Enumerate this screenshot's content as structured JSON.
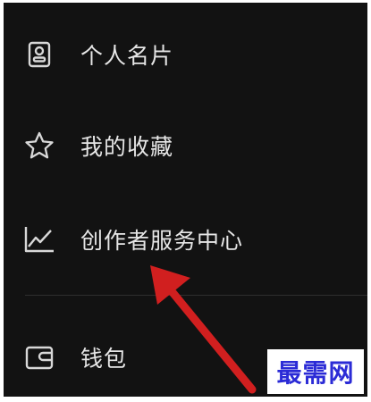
{
  "menu": {
    "items": [
      {
        "label": "个人名片",
        "icon": "contact-card-icon"
      },
      {
        "label": "我的收藏",
        "icon": "star-icon"
      },
      {
        "label": "创作者服务中心",
        "icon": "chart-line-icon"
      },
      {
        "label": "钱包",
        "icon": "wallet-icon"
      }
    ]
  },
  "annotation": {
    "arrow_color": "#d11f1f",
    "target": "创作者服务中心"
  },
  "watermark": {
    "text": "最需网",
    "color": "#2b2bd6"
  },
  "theme": {
    "background": "#121212",
    "text": "#e6e6e6",
    "icon": "#d8d8d8",
    "divider": "#2e2e2e"
  }
}
